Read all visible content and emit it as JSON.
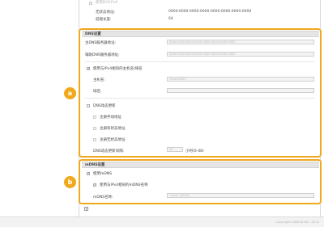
{
  "top": {
    "dhcpv6_label": "使用DHCPv6",
    "stateless_label": "无状态地址:",
    "stateless_value": "0000:0000:0000:0000:0000:0000:0000:0000",
    "prefix_label": "前缀长度:",
    "prefix_value": "64"
  },
  "dns": {
    "section_title": "DNS设置",
    "primary_label": "主DNS服务器地址:",
    "primary_value": "0000:0000:0000:0000:0000:0000:0000:0000",
    "secondary_label": "辅助DNS服务器地址:",
    "secondary_value": "0000:0000:0000:0000:0000:0000:0000:0000",
    "use_ipv4_label": "使用与IPv4相同的主机名/域名",
    "host_label": "主机名:",
    "host_placeholder": "Canon0000",
    "domain_label": "域名:",
    "dyn_update_label": "DNS动态更新",
    "reg_manual_label": "注册手动地址",
    "reg_stateful_label": "注册有状态地址",
    "reg_stateless_label": "注册无状态地址",
    "interval_label": "DNS动态更新间隔:",
    "interval_value": "24",
    "interval_unit": "小时(0-48)"
  },
  "mdns": {
    "section_title": "mDNS设置",
    "use_label": "使用mDNS",
    "same_name_label": "使用与IPv4相同的mDNS名称",
    "name_label": "mDNS名称:",
    "name_placeholder": "Canon [XXXX]"
  },
  "badges": {
    "a": "a",
    "b": "b"
  },
  "footer": {
    "copyright": "Copyright CANON INC. 2015"
  },
  "colors": {
    "highlight": "#f0a81c"
  }
}
